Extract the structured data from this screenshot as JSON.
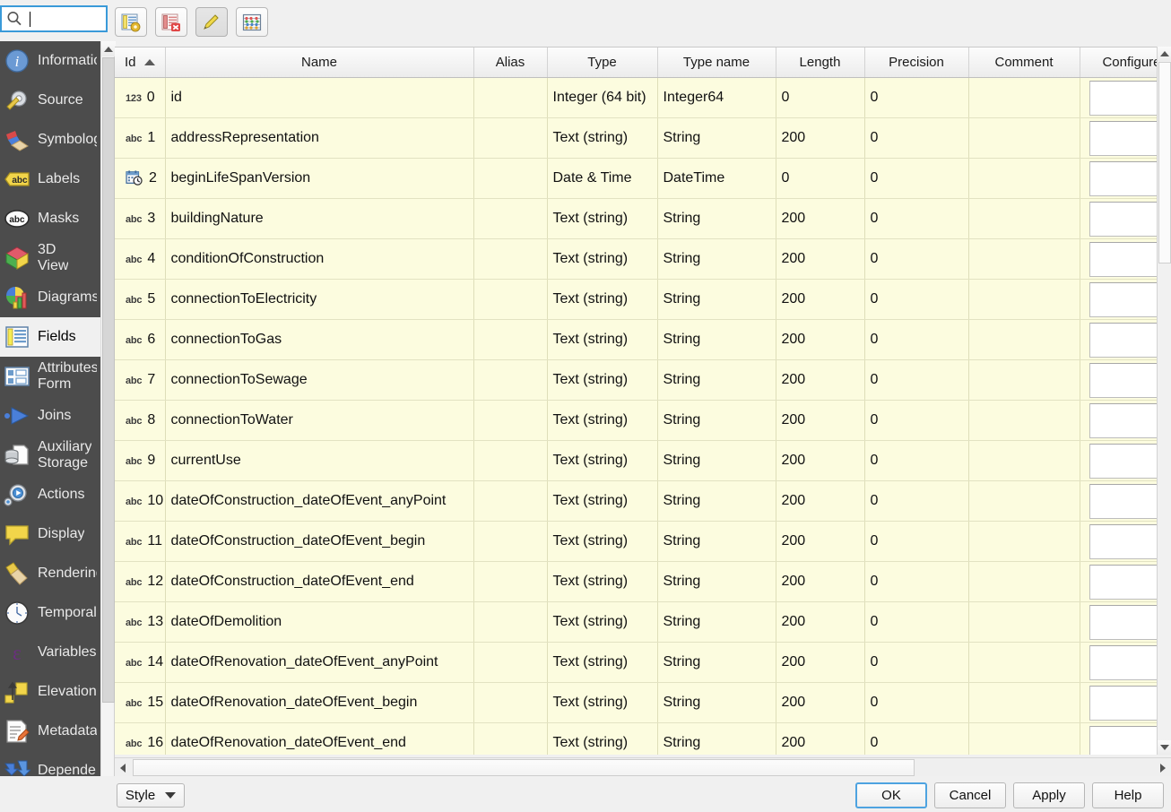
{
  "search": {
    "value": "",
    "placeholder": "",
    "icon": "search-icon"
  },
  "toolbar": {
    "buttons": [
      {
        "name": "new-field-button",
        "title": "New Field",
        "icon": "new-field-icon"
      },
      {
        "name": "delete-field-button",
        "title": "Delete Field",
        "icon": "delete-field-icon"
      },
      {
        "name": "toggle-editing-button",
        "title": "Toggle Editing",
        "icon": "pencil-icon"
      },
      {
        "name": "calculate-field-button",
        "title": "Field Calculator",
        "icon": "abacus-icon"
      }
    ]
  },
  "sidebar": {
    "items": [
      {
        "label": "Information",
        "icon": "information-icon",
        "active": false
      },
      {
        "label": "Source",
        "icon": "source-icon",
        "active": false
      },
      {
        "label": "Symbology",
        "icon": "symbology-icon",
        "active": false
      },
      {
        "label": "Labels",
        "icon": "labels-icon",
        "active": false
      },
      {
        "label": "Masks",
        "icon": "masks-icon",
        "active": false
      },
      {
        "label": "3D\nView",
        "icon": "3d-view-icon",
        "active": false
      },
      {
        "label": "Diagrams",
        "icon": "diagrams-icon",
        "active": false
      },
      {
        "label": "Fields",
        "icon": "fields-icon",
        "active": true
      },
      {
        "label": "Attributes\nForm",
        "icon": "attributes-form-icon",
        "active": false
      },
      {
        "label": "Joins",
        "icon": "joins-icon",
        "active": false
      },
      {
        "label": "Auxiliary\nStorage",
        "icon": "auxiliary-storage-icon",
        "active": false
      },
      {
        "label": "Actions",
        "icon": "actions-icon",
        "active": false
      },
      {
        "label": "Display",
        "icon": "display-icon",
        "active": false
      },
      {
        "label": "Rendering",
        "icon": "rendering-icon",
        "active": false
      },
      {
        "label": "Temporal",
        "icon": "temporal-icon",
        "active": false
      },
      {
        "label": "Variables",
        "icon": "variables-icon",
        "active": false
      },
      {
        "label": "Elevation",
        "icon": "elevation-icon",
        "active": false
      },
      {
        "label": "Metadata",
        "icon": "metadata-icon",
        "active": false
      },
      {
        "label": "Dependencies",
        "icon": "dependencies-icon",
        "active": false
      }
    ]
  },
  "table": {
    "sort_column": "Id",
    "sort_direction": "asc",
    "columns": [
      "Id",
      "Name",
      "Alias",
      "Type",
      "Type name",
      "Length",
      "Precision",
      "Comment",
      "Configure"
    ],
    "rows": [
      {
        "type_icon": "123",
        "id": "0",
        "name": "id",
        "alias": "",
        "type": "Integer (64 bit)",
        "type_name": "Integer64",
        "length": "0",
        "precision": "0",
        "comment": ""
      },
      {
        "type_icon": "abc",
        "id": "1",
        "name": "addressRepresentation",
        "alias": "",
        "type": "Text (string)",
        "type_name": "String",
        "length": "200",
        "precision": "0",
        "comment": ""
      },
      {
        "type_icon": "date",
        "id": "2",
        "name": "beginLifeSpanVersion",
        "alias": "",
        "type": "Date & Time",
        "type_name": "DateTime",
        "length": "0",
        "precision": "0",
        "comment": ""
      },
      {
        "type_icon": "abc",
        "id": "3",
        "name": "buildingNature",
        "alias": "",
        "type": "Text (string)",
        "type_name": "String",
        "length": "200",
        "precision": "0",
        "comment": ""
      },
      {
        "type_icon": "abc",
        "id": "4",
        "name": "conditionOfConstruction",
        "alias": "",
        "type": "Text (string)",
        "type_name": "String",
        "length": "200",
        "precision": "0",
        "comment": ""
      },
      {
        "type_icon": "abc",
        "id": "5",
        "name": "connectionToElectricity",
        "alias": "",
        "type": "Text (string)",
        "type_name": "String",
        "length": "200",
        "precision": "0",
        "comment": ""
      },
      {
        "type_icon": "abc",
        "id": "6",
        "name": "connectionToGas",
        "alias": "",
        "type": "Text (string)",
        "type_name": "String",
        "length": "200",
        "precision": "0",
        "comment": ""
      },
      {
        "type_icon": "abc",
        "id": "7",
        "name": "connectionToSewage",
        "alias": "",
        "type": "Text (string)",
        "type_name": "String",
        "length": "200",
        "precision": "0",
        "comment": ""
      },
      {
        "type_icon": "abc",
        "id": "8",
        "name": "connectionToWater",
        "alias": "",
        "type": "Text (string)",
        "type_name": "String",
        "length": "200",
        "precision": "0",
        "comment": ""
      },
      {
        "type_icon": "abc",
        "id": "9",
        "name": "currentUse",
        "alias": "",
        "type": "Text (string)",
        "type_name": "String",
        "length": "200",
        "precision": "0",
        "comment": ""
      },
      {
        "type_icon": "abc",
        "id": "10",
        "name": "dateOfConstruction_dateOfEvent_anyPoint",
        "alias": "",
        "type": "Text (string)",
        "type_name": "String",
        "length": "200",
        "precision": "0",
        "comment": ""
      },
      {
        "type_icon": "abc",
        "id": "11",
        "name": "dateOfConstruction_dateOfEvent_begin",
        "alias": "",
        "type": "Text (string)",
        "type_name": "String",
        "length": "200",
        "precision": "0",
        "comment": ""
      },
      {
        "type_icon": "abc",
        "id": "12",
        "name": "dateOfConstruction_dateOfEvent_end",
        "alias": "",
        "type": "Text (string)",
        "type_name": "String",
        "length": "200",
        "precision": "0",
        "comment": ""
      },
      {
        "type_icon": "abc",
        "id": "13",
        "name": "dateOfDemolition",
        "alias": "",
        "type": "Text (string)",
        "type_name": "String",
        "length": "200",
        "precision": "0",
        "comment": ""
      },
      {
        "type_icon": "abc",
        "id": "14",
        "name": "dateOfRenovation_dateOfEvent_anyPoint",
        "alias": "",
        "type": "Text (string)",
        "type_name": "String",
        "length": "200",
        "precision": "0",
        "comment": ""
      },
      {
        "type_icon": "abc",
        "id": "15",
        "name": "dateOfRenovation_dateOfEvent_begin",
        "alias": "",
        "type": "Text (string)",
        "type_name": "String",
        "length": "200",
        "precision": "0",
        "comment": ""
      },
      {
        "type_icon": "abc",
        "id": "16",
        "name": "dateOfRenovation_dateOfEvent_end",
        "alias": "",
        "type": "Text (string)",
        "type_name": "String",
        "length": "200",
        "precision": "0",
        "comment": ""
      }
    ]
  },
  "footer": {
    "style_label": "Style",
    "ok_label": "OK",
    "cancel_label": "Cancel",
    "apply_label": "Apply",
    "help_label": "Help"
  },
  "colors": {
    "sidebar_bg": "#4c4c4c",
    "table_row_bg": "#fcfcdf",
    "focus_blue": "#3a9ad9",
    "accent": "#4ea3e0"
  }
}
